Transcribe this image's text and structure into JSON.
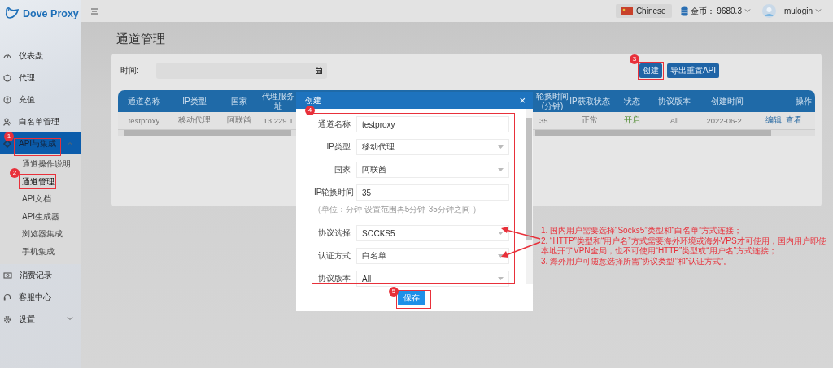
{
  "brand": {
    "name": "Dove Proxy"
  },
  "topbar": {
    "language": "Chinese",
    "coins": "金币： 9680.3",
    "user": "mulogin"
  },
  "sidebar": {
    "items": [
      {
        "label": "仪表盘",
        "selected": false
      },
      {
        "label": "代理",
        "selected": false
      },
      {
        "label": "充值",
        "selected": false
      },
      {
        "label": "白名单管理",
        "selected": false
      },
      {
        "label": "API与集成",
        "selected": true,
        "expanded": true,
        "children": [
          {
            "label": "通道操作说明",
            "selected": false
          },
          {
            "label": "通道管理",
            "selected": true
          },
          {
            "label": "API文档",
            "selected": false
          },
          {
            "label": "API生成器",
            "selected": false
          },
          {
            "label": "浏览器集成",
            "selected": false
          },
          {
            "label": "手机集成",
            "selected": false
          }
        ]
      },
      {
        "label": "消费记录",
        "selected": false
      },
      {
        "label": "客服中心",
        "selected": false
      },
      {
        "label": "设置",
        "selected": false,
        "expanded": false
      }
    ]
  },
  "page": {
    "title": "通道管理",
    "filter": {
      "label": "时间:"
    },
    "buttons": [
      {
        "label": "创建"
      },
      {
        "label": "导出重置API"
      }
    ],
    "table": {
      "columns": [
        "通道名称",
        "IP类型",
        "国家",
        "代理服务址",
        "轮换时间(分钟)",
        "IP获取状态",
        "状态",
        "协议版本",
        "创建时间",
        "操作"
      ],
      "rows": [
        {
          "cells": [
            {
              "kind": "text",
              "text": "testproxy"
            },
            {
              "kind": "text",
              "text": "移动代理"
            },
            {
              "kind": "text",
              "text": "阿联酋"
            },
            {
              "kind": "text",
              "text": "13.229.1"
            },
            {
              "kind": "text",
              "text": "35"
            },
            {
              "kind": "text",
              "text": "正常"
            },
            {
              "kind": "status",
              "text": "开启"
            },
            {
              "kind": "text",
              "text": "All"
            },
            {
              "kind": "text",
              "text": "2022-06-2..."
            },
            {
              "kind": "actions",
              "links": [
                "编辑",
                "查看"
              ]
            }
          ]
        }
      ]
    }
  },
  "dialog": {
    "title": "创建",
    "close": "×",
    "fields": [
      {
        "kind": "input",
        "label": "通道名称",
        "value": "testproxy"
      },
      {
        "kind": "select",
        "label": "IP类型",
        "value": "移动代理"
      },
      {
        "kind": "select",
        "label": "国家",
        "value": "阿联酋"
      },
      {
        "kind": "input",
        "label": "IP轮换时间",
        "value": "35"
      },
      {
        "kind": "hint",
        "text": "（单位：分钟 设置范围再5分钟-35分钟之间 ）"
      },
      {
        "kind": "select",
        "label": "协议选择",
        "value": "SOCKS5"
      },
      {
        "kind": "select",
        "label": "认证方式",
        "value": "白名单"
      },
      {
        "kind": "select",
        "label": "协议版本",
        "value": "All"
      }
    ],
    "save": "保存"
  },
  "annotations": {
    "badges": [
      "1",
      "2",
      "3",
      "4",
      "5"
    ],
    "notes": [
      "1. 国内用户需要选择“Socks5”类型和“白名单”方式连接；",
      "2. “HTTP”类型和“用户名”方式需要海外环境或海外VPS才可使用，国内用户即使本地开了VPN全局，也不可使用“HTTP”类型或“用户名”方式连接；",
      "3. 海外用户可随意选择所需“协议类型”和“认证方式”。"
    ]
  }
}
